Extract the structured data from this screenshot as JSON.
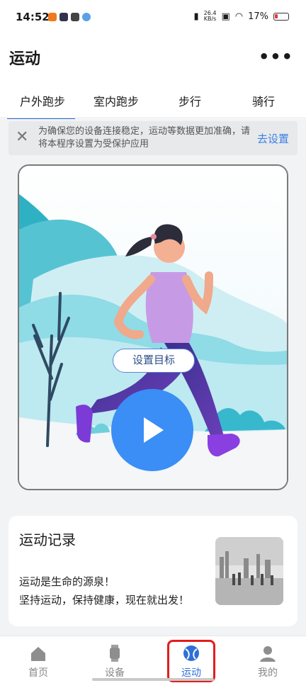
{
  "status": {
    "time": "14:52",
    "net_speed_value": "26.4",
    "net_speed_unit": "KB/s",
    "battery": "17%"
  },
  "header": {
    "title": "运动",
    "more_icon": "more-icon"
  },
  "tabs": [
    {
      "label": "户外跑步",
      "active": true
    },
    {
      "label": "室内跑步",
      "active": false
    },
    {
      "label": "步行",
      "active": false
    },
    {
      "label": "骑行",
      "active": false
    }
  ],
  "banner": {
    "text": "为确保您的设备连接稳定，运动等数据更加准确，请将本程序设置为受保护应用",
    "action": "去设置"
  },
  "hero": {
    "goal_button": "设置目标",
    "play_icon": "play-icon"
  },
  "record": {
    "title": "运动记录",
    "line1": "运动是生命的源泉！",
    "line2": "坚持运动，保持健康，现在就出发！"
  },
  "nav": [
    {
      "label": "首页",
      "icon": "home-icon"
    },
    {
      "label": "设备",
      "icon": "watch-icon"
    },
    {
      "label": "运动",
      "icon": "sport-icon",
      "active": true
    },
    {
      "label": "我的",
      "icon": "profile-icon"
    }
  ],
  "colors": {
    "accent": "#2f6fd8",
    "play": "#3a8ef6",
    "highlight": "#e21d1d"
  }
}
